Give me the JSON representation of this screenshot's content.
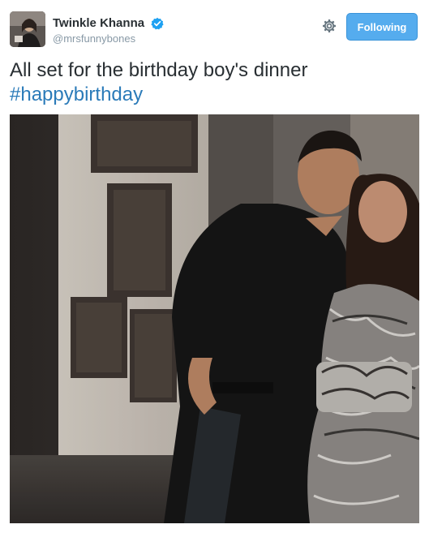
{
  "user": {
    "display_name": "Twinkle Khanna",
    "handle": "@mrsfunnybones",
    "verified": true,
    "avatar_icon": "avatar-photo"
  },
  "actions": {
    "follow_label": "Following",
    "settings_icon": "gear-icon"
  },
  "tweet": {
    "text": "All set for the birthday boy's dinner",
    "hashtag": "#happybirthday"
  },
  "media": {
    "type": "photo",
    "alt": "photo"
  },
  "colors": {
    "accent": "#55acee",
    "hashtag": "#2b7bb9",
    "name": "#292f33",
    "handle": "#8899a6"
  }
}
